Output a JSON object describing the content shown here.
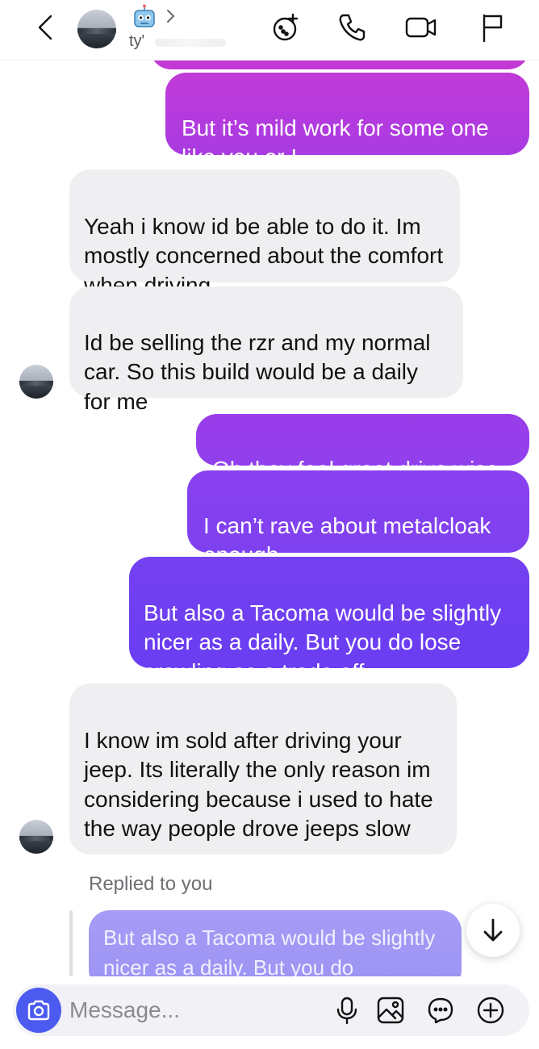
{
  "header": {
    "contact_name": "ty'",
    "icons": [
      "back-chevron-icon",
      "robot-emoji-icon",
      "chevron-right-icon",
      "games-icon",
      "phone-icon",
      "video-icon",
      "flag-icon"
    ]
  },
  "messages": [
    {
      "from": "me",
      "text": "But it’s mild work for some one like you or I"
    },
    {
      "from": "them",
      "text": "Yeah i know id be able to do it. Im mostly concerned about the comfort when driving"
    },
    {
      "from": "them",
      "text": "Id be selling the rzr and my normal car. So this build would be a daily for me"
    },
    {
      "from": "me",
      "text": "Oh they feel great drive wise"
    },
    {
      "from": "me",
      "text": "I can’t rave about metalcloak enough"
    },
    {
      "from": "me",
      "text": "But also a Tacoma would be slightly nicer as a daily. But you do lose crawling as a trade off"
    },
    {
      "from": "them",
      "text": "I know im sold after driving your jeep. Its literally the only reason im considering because i used to hate the way people drove jeeps slow"
    }
  ],
  "reply": {
    "label": "Replied to you",
    "quoted_text": "But also a Tacoma would be slightly nicer as a daily. But you do"
  },
  "composer": {
    "placeholder": "Message...",
    "icons": [
      "camera-icon",
      "microphone-icon",
      "image-icon",
      "sticker-icon",
      "plus-icon"
    ]
  },
  "colors": {
    "outgoing_top": "#c335d8",
    "outgoing_mid": "#8a3ff0",
    "outgoing_bottom": "#6a3df2",
    "incoming": "#efeff2",
    "camera_button": "#4b5bf0"
  }
}
